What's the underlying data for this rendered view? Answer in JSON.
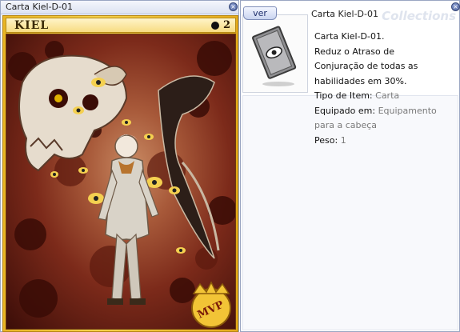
{
  "card_window": {
    "title": "Carta Kiel-D-01",
    "card_name": "KIEL",
    "slot_count": "2",
    "mvp_label": "MVP"
  },
  "info_window": {
    "ver_button": "ver",
    "item_name": "Carta Kiel-D-01",
    "watermark": "Collections",
    "description": {
      "line1": "Carta Kiel-D-01.",
      "line2": "Reduz o Atraso de",
      "line3": "Conjuração de todas as",
      "line4": "habilidades em 30%.",
      "type_label": "Tipo de Item:",
      "type_value": "Carta",
      "equip_label": "Equipado em:",
      "equip_value_1": "Equipamento",
      "equip_value_2": "para a cabeça",
      "weight_label": "Peso:",
      "weight_value": "1"
    }
  },
  "icons": {
    "close": "close-icon",
    "slot": "slot-dot-icon",
    "item": "card-item-icon",
    "mvp": "mvp-crown-icon"
  },
  "colors": {
    "card_gold": "#f0c53a",
    "value_gray": "#7a7a7a",
    "title_blue": "#dde3f2"
  }
}
